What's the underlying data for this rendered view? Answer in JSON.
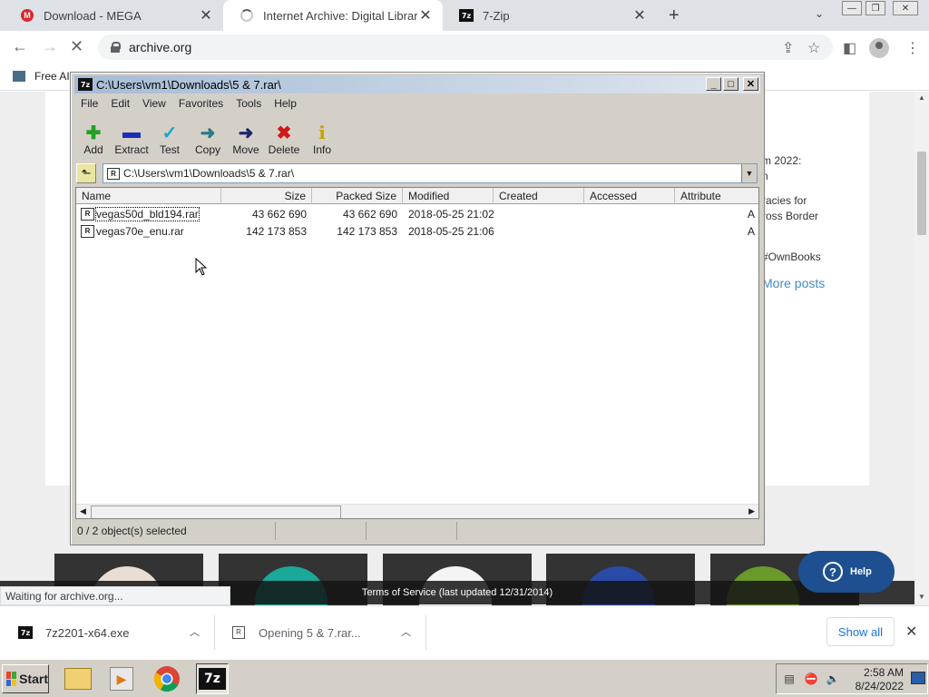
{
  "browser": {
    "tabs": [
      {
        "title": "Download - MEGA",
        "icon": "mega-icon",
        "active": false
      },
      {
        "title": "Internet Archive: Digital Library o",
        "icon": "loading-spinner-icon",
        "active": true
      },
      {
        "title": "7-Zip",
        "icon": "7zip-icon",
        "active": false
      }
    ],
    "url": "archive.org",
    "bookmark": "Free AI"
  },
  "page": {
    "side_lines": [
      "m 2022:",
      "n",
      "racies for",
      "ross Border",
      "#OwnBooks"
    ],
    "more_posts": "More posts",
    "tos": "Terms of Service (last updated 12/31/2014)",
    "help_label": "Help",
    "status": "Waiting for archive.org..."
  },
  "downloads": {
    "items": [
      {
        "name": "7z2201-x64.exe"
      },
      {
        "name": "Opening 5 & 7.rar..."
      }
    ],
    "show_all": "Show all"
  },
  "sevenzip": {
    "title": "C:\\Users\\vm1\\Downloads\\5 & 7.rar\\",
    "menu": [
      "File",
      "Edit",
      "View",
      "Favorites",
      "Tools",
      "Help"
    ],
    "toolbar": [
      {
        "label": "Add",
        "glyph": "✚",
        "color": "#22a022",
        "icon": "add-icon"
      },
      {
        "label": "Extract",
        "glyph": "▬",
        "color": "#1c2fb5",
        "icon": "extract-icon"
      },
      {
        "label": "Test",
        "glyph": "✓",
        "color": "#1aa8c8",
        "icon": "test-icon"
      },
      {
        "label": "Copy",
        "glyph": "➜",
        "color": "#2a7a8a",
        "icon": "copy-icon"
      },
      {
        "label": "Move",
        "glyph": "➜",
        "color": "#1c2670",
        "icon": "move-icon"
      },
      {
        "label": "Delete",
        "glyph": "✖",
        "color": "#d01818",
        "icon": "delete-icon"
      },
      {
        "label": "Info",
        "glyph": "i",
        "color": "#c8a000",
        "icon": "info-icon"
      }
    ],
    "path": "C:\\Users\\vm1\\Downloads\\5 & 7.rar\\",
    "columns": [
      "Name",
      "Size",
      "Packed Size",
      "Modified",
      "Created",
      "Accessed",
      "Attribute"
    ],
    "files": [
      {
        "name": "vegas50d_bld194.rar",
        "size": "43 662 690",
        "packed": "43 662 690",
        "modified": "2018-05-25 21:02",
        "created": "",
        "accessed": "",
        "attr": "A"
      },
      {
        "name": "vegas70e_enu.rar",
        "size": "142 173 853",
        "packed": "142 173 853",
        "modified": "2018-05-25 21:06",
        "created": "",
        "accessed": "",
        "attr": "A"
      }
    ],
    "status": "0 / 2 object(s) selected"
  },
  "taskbar": {
    "start": "Start",
    "time": "2:58 AM",
    "date": "8/24/2022"
  }
}
